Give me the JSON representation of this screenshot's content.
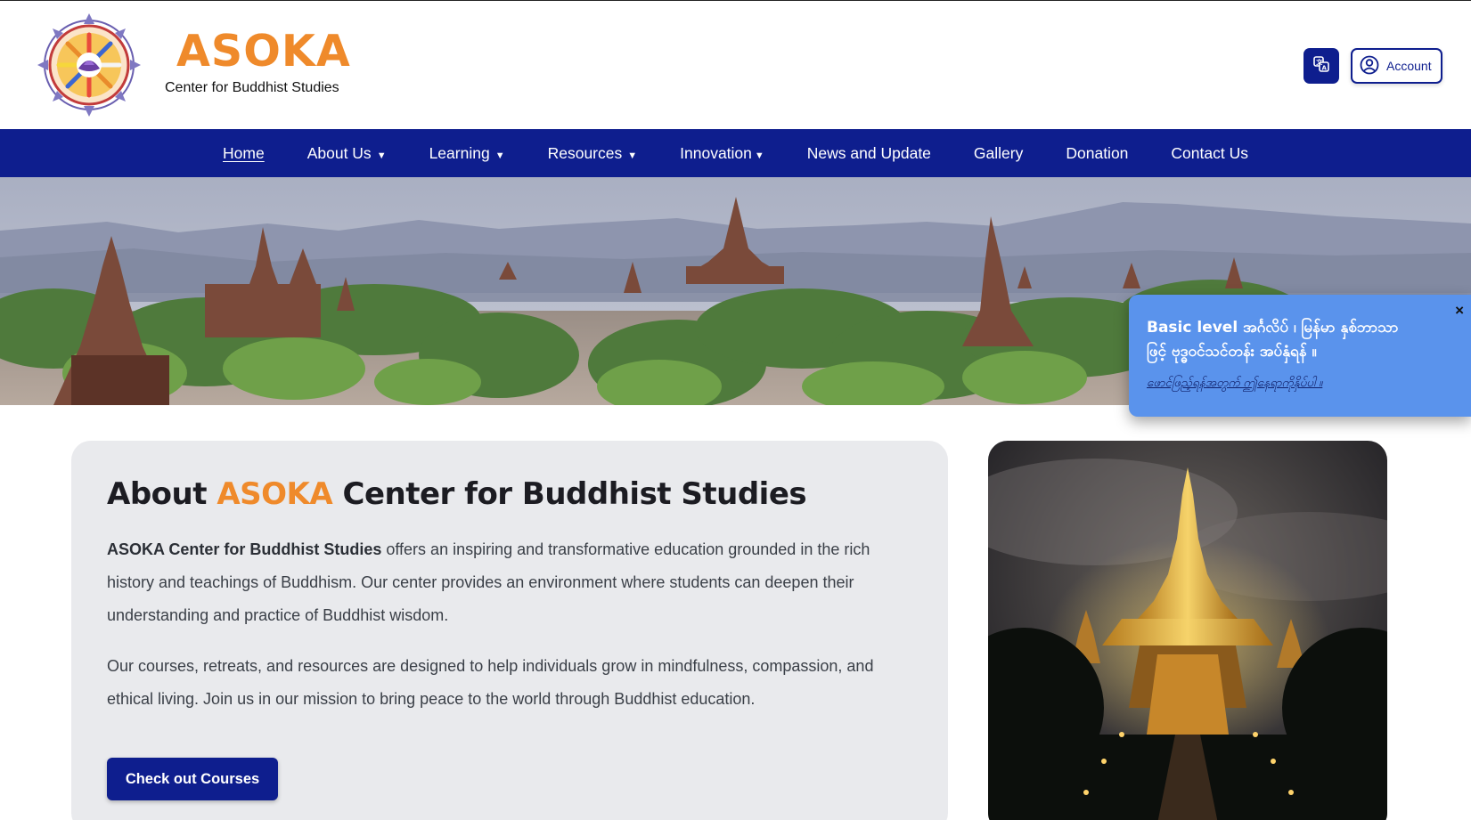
{
  "header": {
    "brand_title": "ASOKA",
    "brand_subtitle": "Center for Buddhist Studies",
    "account_label": "Account",
    "logo_icon": "lotus-mandala-logo",
    "translate_icon": "translate-icon",
    "account_icon": "user-circle-icon"
  },
  "nav": {
    "items": [
      {
        "label": "Home",
        "has_dropdown": false,
        "active": true
      },
      {
        "label": "About Us",
        "has_dropdown": true
      },
      {
        "label": "Learning",
        "has_dropdown": true
      },
      {
        "label": "Resources",
        "has_dropdown": true
      },
      {
        "label": "Innovation",
        "has_dropdown": true
      },
      {
        "label": "News and Update",
        "has_dropdown": false
      },
      {
        "label": "Gallery",
        "has_dropdown": false
      },
      {
        "label": "Donation",
        "has_dropdown": false
      },
      {
        "label": "Contact Us",
        "has_dropdown": false
      }
    ],
    "caret": "▼"
  },
  "popup": {
    "title": "Basic level အင်္ဂလိပ် ၊ မြန်မာ နှစ်ဘာသာဖြင့် ဗုဒ္ဓဝင်သင်တန်း အပ်နှံရန် ။",
    "link": "ဖောင်ဖြည့်ရန်အတွက် ဤနေရာကိုနှိပ်ပါ ။",
    "close": "×"
  },
  "about": {
    "title_prefix": "About ",
    "title_accent": "ASOKA",
    "title_suffix": " Center for Buddhist Studies",
    "p1_bold": "ASOKA Center for Buddhist Studies",
    "p1_rest": " offers an inspiring and transformative education grounded in the rich history and teachings of Buddhism. Our center provides an environment where students can deepen their understanding and practice of Buddhist wisdom.",
    "p2": "Our courses, retreats, and resources are designed to help individuals grow in mindfulness, compassion, and ethical living. Join us in our mission to bring peace to the world through Buddhist education.",
    "cta_label": "Check out Courses"
  },
  "colors": {
    "brand_orange": "#ef8a2b",
    "navy": "#0e1e8e",
    "popup_blue": "#5a93ec",
    "card_gray": "#e9eaed"
  }
}
